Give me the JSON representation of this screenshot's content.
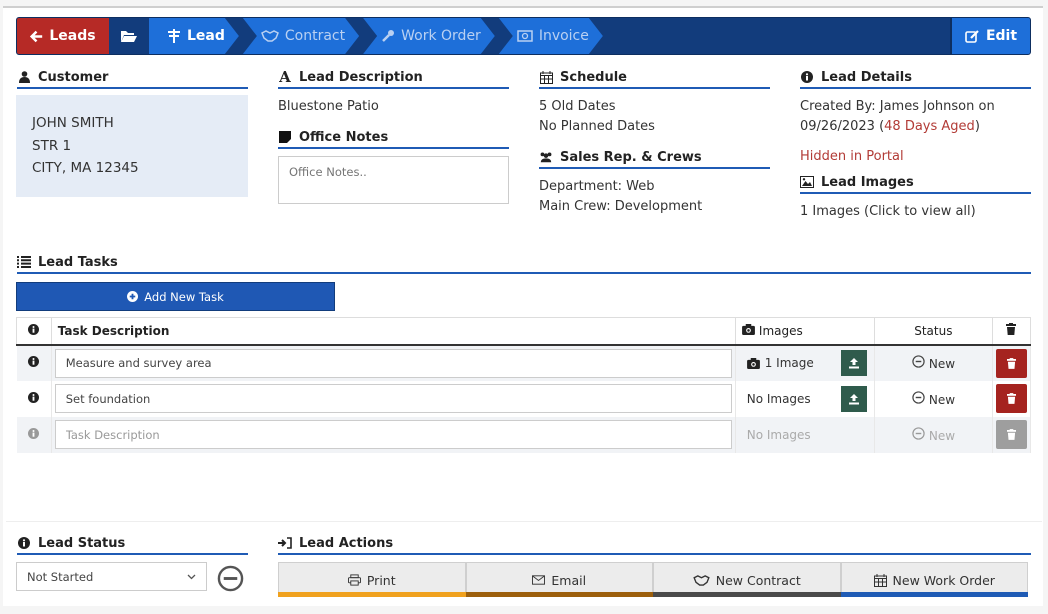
{
  "nav": {
    "back_label": "Leads",
    "crumbs": [
      {
        "label": "Lead",
        "icon": "signpost-icon",
        "active": true
      },
      {
        "label": "Contract",
        "icon": "handshake-icon",
        "active": false
      },
      {
        "label": "Work Order",
        "icon": "wrench-icon",
        "active": false
      },
      {
        "label": "Invoice",
        "icon": "money-bill-icon",
        "active": false
      }
    ],
    "edit_label": "Edit"
  },
  "customer": {
    "heading": "Customer",
    "name": "JOHN SMITH",
    "street": "STR 1",
    "city": "CITY, MA 12345"
  },
  "lead_description": {
    "heading": "Lead Description",
    "value": "Bluestone Patio"
  },
  "office_notes": {
    "heading": "Office Notes",
    "placeholder": "Office Notes..",
    "value": ""
  },
  "schedule": {
    "heading": "Schedule",
    "old_dates": "5 Old Dates",
    "planned_dates": "No Planned Dates"
  },
  "sales_crews": {
    "heading": "Sales Rep. & Crews",
    "department": "Department: Web",
    "main_crew": "Main Crew: Development"
  },
  "lead_details": {
    "heading": "Lead Details",
    "created_by": "Created By: James Johnson on",
    "created_date": "09/26/2023",
    "aged": "48 Days Aged",
    "portal": "Hidden in Portal"
  },
  "lead_images": {
    "heading": "Lead Images",
    "summary": "1 Images (Click to view all)"
  },
  "tasks": {
    "heading": "Lead Tasks",
    "add_label": "Add New Task",
    "columns": {
      "description": "Task Description",
      "images": "Images",
      "status": "Status"
    },
    "rows": [
      {
        "description": "Measure and survey area",
        "images": "1 Image",
        "status": "New"
      },
      {
        "description": "Set foundation",
        "images": "No Images",
        "status": "New"
      }
    ],
    "new_row": {
      "placeholder": "Task Description",
      "images": "No Images",
      "status": "New"
    }
  },
  "lead_status": {
    "heading": "Lead Status",
    "selected": "Not Started"
  },
  "lead_actions": {
    "heading": "Lead Actions",
    "buttons": [
      {
        "label": "Print",
        "bar_color": "#f0a11e"
      },
      {
        "label": "Email",
        "bar_color": "#9c5f0c"
      },
      {
        "label": "New Contract",
        "bar_color": "#4a4a4a"
      },
      {
        "label": "New Work Order",
        "bar_color": "#1f5bb5"
      }
    ]
  },
  "colors": {
    "primary": "#1e6fd9",
    "nav_dark": "#123c7c",
    "danger": "#b62a26",
    "accent_red_text": "#b23b36",
    "upload_green": "#2f5b4c"
  }
}
